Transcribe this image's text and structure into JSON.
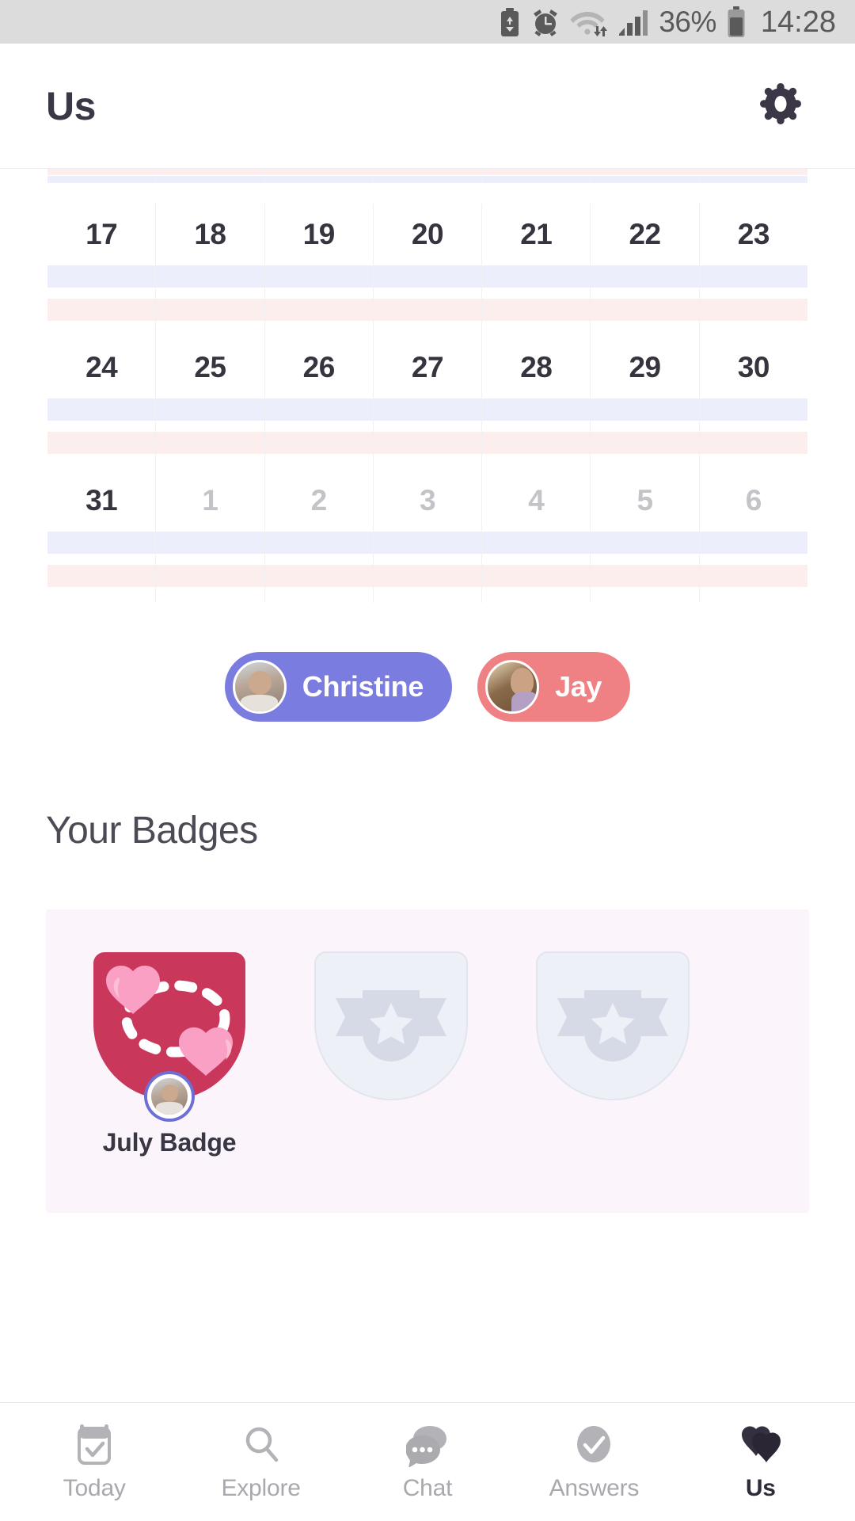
{
  "status_bar": {
    "battery_percent": "36%",
    "time": "14:28",
    "icons": [
      "battery-saver-icon",
      "alarm-icon",
      "wifi-icon",
      "signal-icon",
      "battery-icon"
    ]
  },
  "header": {
    "title": "Us",
    "settings_icon": "gear-icon"
  },
  "calendar": {
    "weeks": [
      {
        "days": [
          {
            "num": "17",
            "muted": false
          },
          {
            "num": "18",
            "muted": false
          },
          {
            "num": "19",
            "muted": false
          },
          {
            "num": "20",
            "muted": false
          },
          {
            "num": "21",
            "muted": false
          },
          {
            "num": "22",
            "muted": false
          },
          {
            "num": "23",
            "muted": false
          }
        ]
      },
      {
        "days": [
          {
            "num": "24",
            "muted": false
          },
          {
            "num": "25",
            "muted": false
          },
          {
            "num": "26",
            "muted": false
          },
          {
            "num": "27",
            "muted": false
          },
          {
            "num": "28",
            "muted": false
          },
          {
            "num": "29",
            "muted": false
          },
          {
            "num": "30",
            "muted": false
          }
        ]
      },
      {
        "days": [
          {
            "num": "31",
            "muted": false
          },
          {
            "num": "1",
            "muted": true
          },
          {
            "num": "2",
            "muted": true
          },
          {
            "num": "3",
            "muted": true
          },
          {
            "num": "4",
            "muted": true
          },
          {
            "num": "5",
            "muted": true
          },
          {
            "num": "6",
            "muted": true
          }
        ]
      }
    ],
    "bar_colors": {
      "blue": "#eceefb",
      "pink": "#fdeeee"
    }
  },
  "people": [
    {
      "name": "Christine",
      "color": "#7b7ce0",
      "avatar": "christine-avatar"
    },
    {
      "name": "Jay",
      "color": "#ef8084",
      "avatar": "jay-avatar"
    }
  ],
  "badges": {
    "section_title": "Your Badges",
    "items": [
      {
        "label": "July Badge",
        "locked": false,
        "shield_color": "#c9375b",
        "heart_color": "#f9a0c4"
      },
      {
        "label": "",
        "locked": true
      },
      {
        "label": "",
        "locked": true
      }
    ]
  },
  "bottom_nav": {
    "items": [
      {
        "label": "Today",
        "icon": "calendar-check-icon",
        "active": false
      },
      {
        "label": "Explore",
        "icon": "search-icon",
        "active": false
      },
      {
        "label": "Chat",
        "icon": "chat-bubbles-icon",
        "active": false
      },
      {
        "label": "Answers",
        "icon": "check-circle-icon",
        "active": false
      },
      {
        "label": "Us",
        "icon": "hearts-icon",
        "active": true
      }
    ]
  }
}
